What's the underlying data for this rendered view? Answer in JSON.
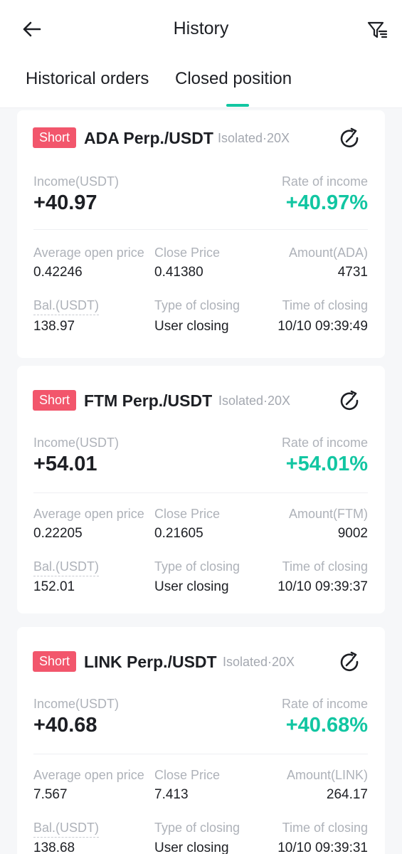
{
  "header": {
    "title": "History",
    "tabs": [
      {
        "label": "Historical orders",
        "active": false
      },
      {
        "label": "Closed position",
        "active": true
      }
    ]
  },
  "labels": {
    "income": "Income(USDT)",
    "rate": "Rate of income",
    "avg_open": "Average open price",
    "close_price": "Close Price",
    "balance": "Bal.(USDT)",
    "type_closing": "Type of closing",
    "time_closing": "Time of closing"
  },
  "positions": [
    {
      "side": "Short",
      "symbol": "ADA Perp./USDT",
      "mode": "Isolated·20X",
      "income": "+40.97",
      "rate": "+40.97%",
      "amount_label": "Amount(ADA)",
      "avg_open": "0.42246",
      "close_price": "0.41380",
      "amount": "4731",
      "balance": "138.97",
      "type_closing": "User closing",
      "time_closing": "10/10 09:39:49"
    },
    {
      "side": "Short",
      "symbol": "FTM Perp./USDT",
      "mode": "Isolated·20X",
      "income": "+54.01",
      "rate": "+54.01%",
      "amount_label": "Amount(FTM)",
      "avg_open": "0.22205",
      "close_price": "0.21605",
      "amount": "9002",
      "balance": "152.01",
      "type_closing": "User closing",
      "time_closing": "10/10 09:39:37"
    },
    {
      "side": "Short",
      "symbol": "LINK Perp./USDT",
      "mode": "Isolated·20X",
      "income": "+40.68",
      "rate": "+40.68%",
      "amount_label": "Amount(LINK)",
      "avg_open": "7.567",
      "close_price": "7.413",
      "amount": "264.17",
      "balance": "138.68",
      "type_closing": "User closing",
      "time_closing": "10/10 09:39:31"
    }
  ],
  "colors": {
    "accent": "#12c6a2",
    "short_badge": "#f2566c",
    "muted_text": "#aeb2b9"
  },
  "icons": {
    "back": "arrow-left-icon",
    "filter": "filter-icon",
    "share": "share-refresh-icon"
  }
}
